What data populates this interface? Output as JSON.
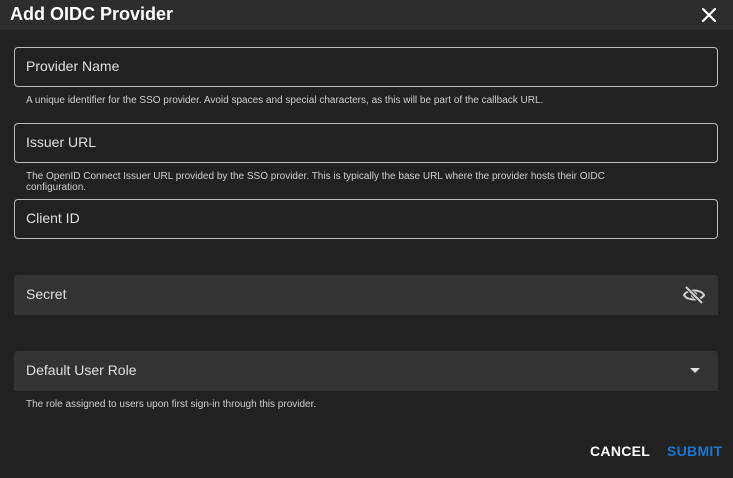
{
  "dialog": {
    "title": "Add OIDC Provider",
    "close_icon": "close-icon"
  },
  "fields": {
    "provider_name": {
      "label": "Provider Name",
      "value": "",
      "hint": "A unique identifier for the SSO provider. Avoid spaces and special characters, as this will be part of the callback URL."
    },
    "issuer_url": {
      "label": "Issuer URL",
      "value": "",
      "hint": "The OpenID Connect Issuer URL provided by the SSO provider. This is typically the base URL where the provider hosts their OIDC configuration."
    },
    "client_id": {
      "label": "Client ID",
      "value": ""
    },
    "secret": {
      "label": "Secret",
      "value": "",
      "toggle_icon": "eye-off-icon"
    },
    "default_user_role": {
      "label": "Default User Role",
      "value": "",
      "hint": "The role assigned to users upon first sign-in through this provider.",
      "dropdown_icon": "caret-down-icon"
    }
  },
  "actions": {
    "cancel_label": "CANCEL",
    "submit_label": "SUBMIT"
  },
  "colors": {
    "background": "#212121",
    "header": "#2d2d2d",
    "filled_field": "#333333",
    "accent": "#1976d2"
  }
}
